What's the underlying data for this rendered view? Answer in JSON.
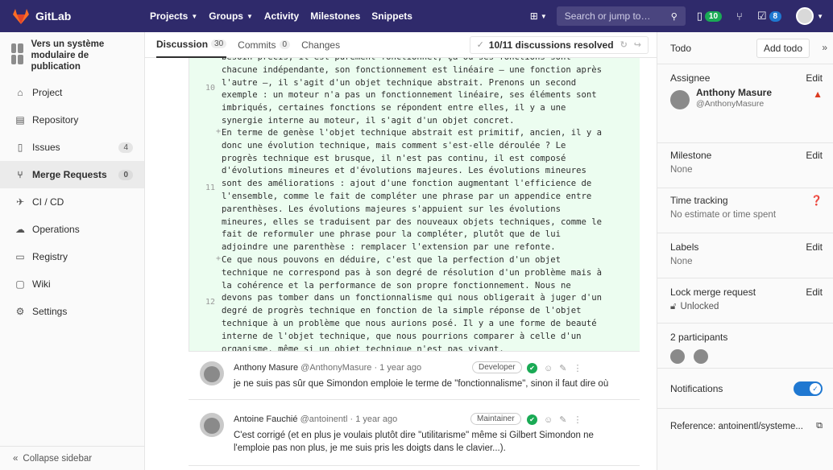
{
  "navbar": {
    "brand": "GitLab",
    "links": [
      {
        "label": "Projects",
        "dropdown": true
      },
      {
        "label": "Groups",
        "dropdown": true
      },
      {
        "label": "Activity",
        "dropdown": false
      },
      {
        "label": "Milestones",
        "dropdown": false
      },
      {
        "label": "Snippets",
        "dropdown": false
      }
    ],
    "search_placeholder": "Search or jump to…",
    "issues_count": "10",
    "todos_count": "8",
    "colors": {
      "bar": "#2f2a6b",
      "green": "#1aaa55",
      "blue": "#1f78d1"
    }
  },
  "sidebar": {
    "project_name": "Vers un système modulaire de publication",
    "items": [
      {
        "label": "Project",
        "icon": "home-icon",
        "count": ""
      },
      {
        "label": "Repository",
        "icon": "doc-icon",
        "count": ""
      },
      {
        "label": "Issues",
        "icon": "issues-icon",
        "count": "4"
      },
      {
        "label": "Merge Requests",
        "icon": "merge-icon",
        "count": "0"
      },
      {
        "label": "CI / CD",
        "icon": "rocket-icon",
        "count": ""
      },
      {
        "label": "Operations",
        "icon": "cloud-icon",
        "count": ""
      },
      {
        "label": "Registry",
        "icon": "registry-icon",
        "count": ""
      },
      {
        "label": "Wiki",
        "icon": "book-icon",
        "count": ""
      },
      {
        "label": "Settings",
        "icon": "gear-icon",
        "count": ""
      }
    ],
    "collapse_label": "Collapse sidebar"
  },
  "tabs": {
    "discussion": "Discussion",
    "discussion_count": "30",
    "commits": "Commits",
    "commits_count": "0",
    "changes": "Changes",
    "resolved": "10/11 discussions resolved"
  },
  "diff": {
    "line10_no": "10",
    "line10": "besoin précis, il est purement fonctionnel, ça où ses fonctions sont\nchacune indépendante, son fonctionnement est linéaire — une fonction après\nl'autre —, il s'agit d'un objet technique abstrait. Prenons un second\nexemple : un moteur n'a pas un fonctionnement linéaire, ses éléments sont\nimbriqués, certaines fonctions se répondent entre elles, il y a une\nsynergie interne au moteur, il s'agit d'un objet concret.",
    "line11_no": "11",
    "line11": "En terme de genèse l'objet technique abstrait est primitif, ancien, il y a\ndonc une évolution technique, mais comment s'est-elle déroulée ? Le\nprogrès technique est brusque, il n'est pas continu, il est composé\nd'évolutions mineures et d'évolutions majeures. Les évolutions mineures\nsont des améliorations : ajout d'une fonction augmentant l'efficience de\nl'ensemble, comme le fait de compléter une phrase par un appendice entre\nparenthèses. Les évolutions majeures s'appuient sur les évolutions\nmineures, elles se traduisent par des nouveaux objets techniques, comme le\nfait de reformuler une phrase pour la compléter, plutôt que de lui\nadjoindre une parenthèse : remplacer l'extension par une refonte.",
    "line12_no": "12",
    "line12": "Ce que nous pouvons en déduire, c'est que la perfection d'un objet\ntechnique ne correspond pas à son degré de résolution d'un problème mais à\nla cohérence et la performance de son propre fonctionnement. Nous ne\ndevons pas tomber dans un fonctionnalisme qui nous obligerait à juger d'un\ndegré de progrès technique en fonction de la simple réponse de l'objet\ntechnique à un problème que nous aurions posé. Il y a une forme de beauté\ninterne de l'objet technique, que nous pourrions comparer à celle d'un\norganisme, même si un objet technique n'est pas vivant.",
    "plus": "+"
  },
  "comments": [
    {
      "author": "Anthony Masure",
      "handle": "@AnthonyMasure",
      "time": "· 1 year ago",
      "role": "Developer",
      "body": "je ne suis pas sûr que Simondon emploie le terme de \"fonctionnalisme\", sinon il faut dire où"
    },
    {
      "author": "Antoine Fauchié",
      "handle": "@antoinentl",
      "time": "· 1 year ago",
      "role": "Maintainer",
      "body": "C'est corrigé (et en plus je voulais plutôt dire \"utilitarisme\" même si Gilbert Simondon ne l'emploie pas non plus, je me suis pris les doigts dans le clavier...)."
    }
  ],
  "right": {
    "todo": "Todo",
    "add_todo": "Add todo",
    "assignee_title": "Assignee",
    "assignee_name": "Anthony Masure",
    "assignee_handle": "@AnthonyMasure",
    "edit": "Edit",
    "milestone_title": "Milestone",
    "milestone_val": "None",
    "time_title": "Time tracking",
    "time_val": "No estimate or time spent",
    "labels_title": "Labels",
    "labels_val": "None",
    "lock_title": "Lock merge request",
    "lock_val": "Unlocked",
    "participants_title": "2 participants",
    "notifications": "Notifications",
    "reference": "Reference: antoinentl/systeme..."
  }
}
